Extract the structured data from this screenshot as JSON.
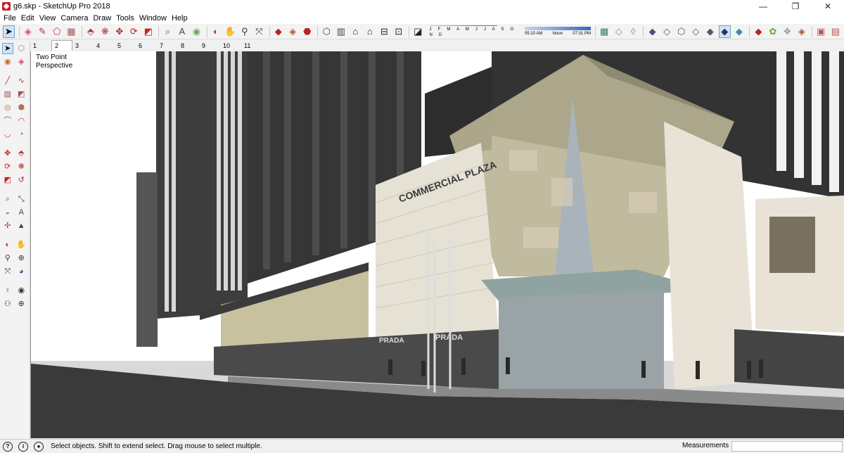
{
  "window": {
    "title": "g6.skp - SketchUp Pro 2018",
    "minimize": "—",
    "maximize": "❐",
    "close": "✕"
  },
  "menu": [
    "File",
    "Edit",
    "View",
    "Camera",
    "Draw",
    "Tools",
    "Window",
    "Help"
  ],
  "toolbar": {
    "shadow_months": "J F M A M J J A S O N D",
    "time_start": "05:10 AM",
    "time_mid": "Noon",
    "time_end": "07:31 PM"
  },
  "scenes": [
    "1",
    "2",
    "3",
    "4",
    "5",
    "6",
    "7",
    "8",
    "9",
    "10",
    "11"
  ],
  "active_scene": "2",
  "viewport": {
    "camera_mode_line1": "Two Point",
    "camera_mode_line2": "Perspective",
    "sign_name": "COMMERCIAL PLAZA",
    "store_sign": "PRADA"
  },
  "status": {
    "message": "Select objects. Shift to extend select. Drag mouse to select multiple.",
    "measurements_label": "Measurements",
    "measurements_value": ""
  },
  "colors": {
    "selected_tool_bg": "#cfe3f7",
    "sky": "#ffffff",
    "road": "#3a3a3a"
  }
}
